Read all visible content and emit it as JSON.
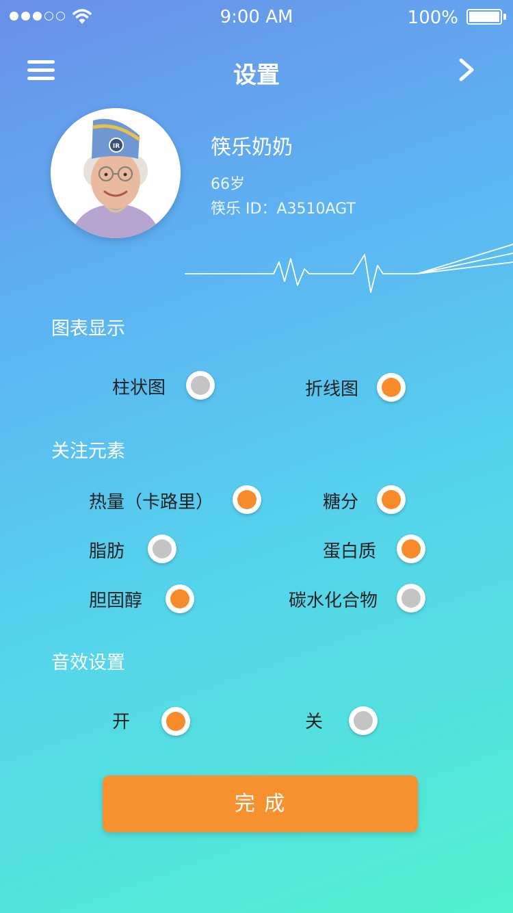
{
  "status_bar": {
    "time": "9:00 AM",
    "battery": "100%"
  },
  "header": {
    "title": "设置"
  },
  "profile": {
    "name": "筷乐奶奶",
    "age": "66岁",
    "id_text": "筷乐 ID：A3510AGT",
    "avatar_badge": "IR"
  },
  "chart_section": {
    "title": "图表显示",
    "options": [
      {
        "label": "柱状图",
        "selected": false
      },
      {
        "label": "折线图",
        "selected": true
      }
    ]
  },
  "focus_section": {
    "title": "关注元素",
    "options": [
      {
        "label": "热量（卡路里）",
        "selected": true
      },
      {
        "label": "糖分",
        "selected": true
      },
      {
        "label": "脂肪",
        "selected": false
      },
      {
        "label": "蛋白质",
        "selected": true
      },
      {
        "label": "胆固醇",
        "selected": true
      },
      {
        "label": "碳水化合物",
        "selected": false
      }
    ]
  },
  "sound_section": {
    "title": "音效设置",
    "options": [
      {
        "label": "开",
        "selected": true
      },
      {
        "label": "关",
        "selected": false
      }
    ]
  },
  "done_button": {
    "label": "完 成"
  },
  "colors": {
    "accent": "#f68b2c",
    "radio_off": "#c4c4c4",
    "label": "#222222"
  }
}
